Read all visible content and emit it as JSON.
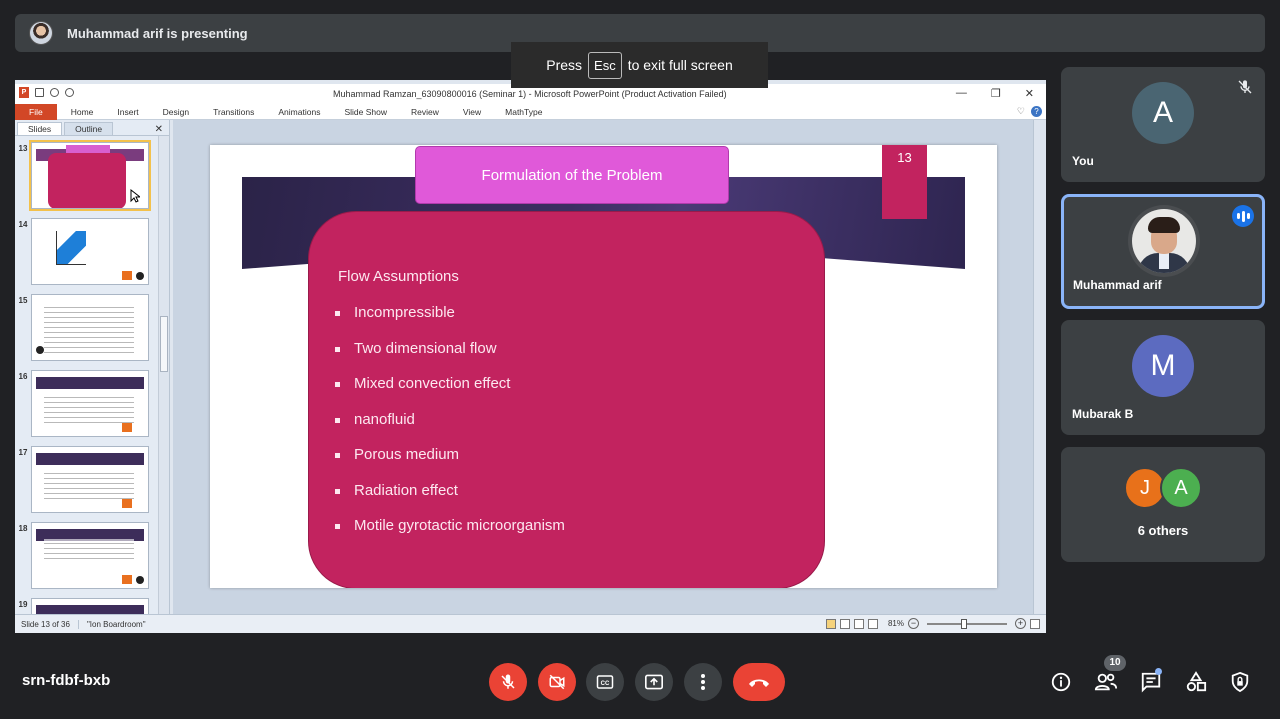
{
  "presenter_banner": {
    "text": "Muhammad arif is presenting"
  },
  "fullscreen_hint": {
    "before": "Press",
    "key": "Esc",
    "after": "to exit full screen"
  },
  "powerpoint": {
    "window_title": "Muhammad Ramzan_63090800016 (Seminar 1)  -  Microsoft PowerPoint (Product Activation Failed)",
    "ribbon_tabs": [
      "File",
      "Home",
      "Insert",
      "Design",
      "Transitions",
      "Animations",
      "Slide Show",
      "Review",
      "View",
      "MathType"
    ],
    "pane_tabs": [
      "Slides",
      "Outline"
    ],
    "thumbnails": [
      "13",
      "14",
      "15",
      "16",
      "17",
      "18",
      "19"
    ],
    "slide": {
      "title": "Formulation of the Problem",
      "number": "13",
      "heading": "Flow Assumptions",
      "bullets": [
        "Incompressible",
        "Two dimensional flow",
        "Mixed convection effect",
        "nanofluid",
        "Porous medium",
        "Radiation effect",
        "Motile gyrotactic microorganism"
      ]
    },
    "status": {
      "slide_info": "Slide 13 of 36",
      "theme": "\"Ion Boardroom\"",
      "zoom": "81%"
    }
  },
  "participants": [
    {
      "name": "You",
      "initial": "A",
      "color": "#4a6572"
    },
    {
      "name": "Muhammad arif"
    },
    {
      "name": "Mubarak B",
      "initial": "M",
      "color": "#5c6bc0"
    }
  ],
  "others": {
    "label": "6 others",
    "initials": [
      "J",
      "A"
    ],
    "colors": [
      "#e8711a",
      "#4caf50"
    ]
  },
  "meeting_code": "srn-fdbf-bxb",
  "people_count": "10",
  "accent_color": "#8ab4f8",
  "danger_color": "#ea4335"
}
